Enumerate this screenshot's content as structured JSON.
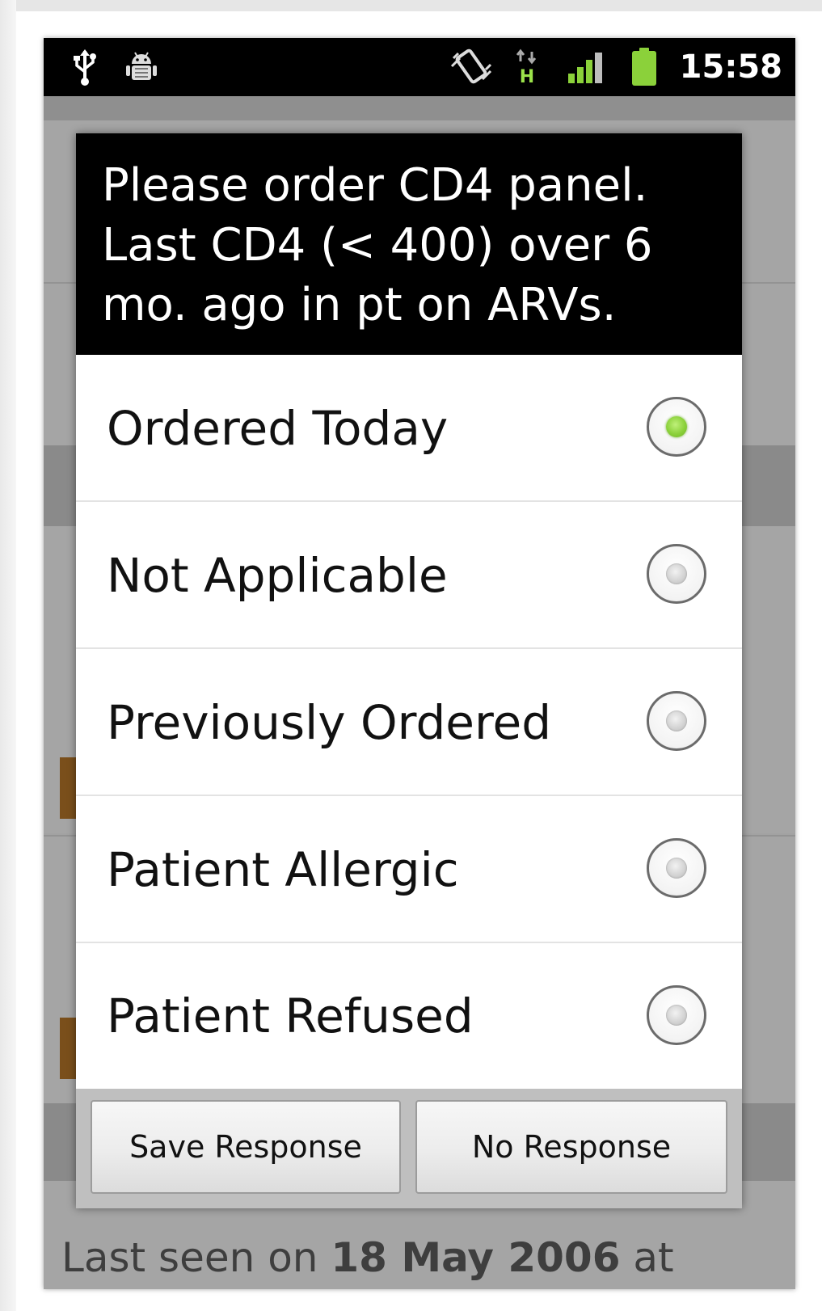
{
  "status_bar": {
    "time": "15:58",
    "icons": [
      "usb-icon",
      "android-debug-icon",
      "vibrate-icon",
      "hspa-data-icon",
      "signal-strength-icon",
      "battery-icon"
    ],
    "colors": {
      "background": "#000000",
      "green": "#8bd13a"
    }
  },
  "background": {
    "footer_text_prefix": "Last seen on ",
    "footer_text_date": "18 May 2006",
    "footer_text_suffix": " at"
  },
  "dialog": {
    "title": "Please order CD4 panel. Last CD4 (< 400) over 6 mo. ago in pt on ARVs.",
    "options": [
      {
        "label": "Ordered Today",
        "selected": true
      },
      {
        "label": "Not Applicable",
        "selected": false
      },
      {
        "label": "Previously Ordered",
        "selected": false
      },
      {
        "label": "Patient Allergic",
        "selected": false
      },
      {
        "label": "Patient Refused",
        "selected": false
      }
    ],
    "buttons": {
      "save": "Save Response",
      "no_response": "No Response"
    }
  }
}
